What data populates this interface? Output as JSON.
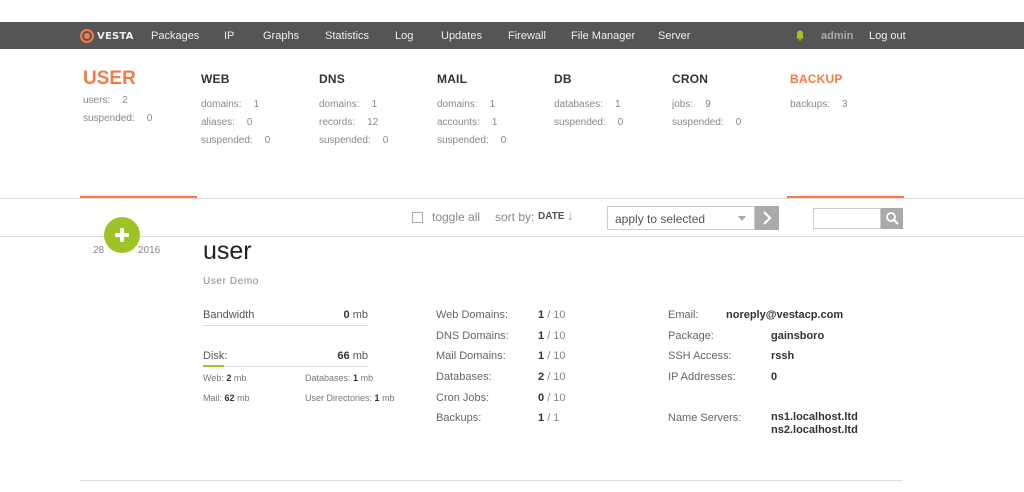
{
  "app": {
    "logo_text": "VESTA"
  },
  "nav": {
    "items": [
      {
        "label": "Packages"
      },
      {
        "label": "IP"
      },
      {
        "label": "Graphs"
      },
      {
        "label": "Statistics"
      },
      {
        "label": "Log"
      },
      {
        "label": "Updates"
      },
      {
        "label": "Firewall"
      },
      {
        "label": "File Manager"
      },
      {
        "label": "Server"
      }
    ],
    "bell_icon": "bell-icon",
    "user": "admin",
    "logout": "Log out"
  },
  "stats": {
    "user": {
      "title": "USER",
      "rows": [
        {
          "label": "users:",
          "value": "2"
        },
        {
          "label": "suspended:",
          "value": "0"
        }
      ]
    },
    "web": {
      "title": "WEB",
      "rows": [
        {
          "label": "domains:",
          "value": "1"
        },
        {
          "label": "aliases:",
          "value": "0"
        },
        {
          "label": "suspended:",
          "value": "0"
        }
      ]
    },
    "dns": {
      "title": "DNS",
      "rows": [
        {
          "label": "domains:",
          "value": "1"
        },
        {
          "label": "records:",
          "value": "12"
        },
        {
          "label": "suspended:",
          "value": "0"
        }
      ]
    },
    "mail": {
      "title": "MAIL",
      "rows": [
        {
          "label": "domains:",
          "value": "1"
        },
        {
          "label": "accounts:",
          "value": "1"
        },
        {
          "label": "suspended:",
          "value": "0"
        }
      ]
    },
    "db": {
      "title": "DB",
      "rows": [
        {
          "label": "databases:",
          "value": "1"
        },
        {
          "label": "suspended:",
          "value": "0"
        }
      ]
    },
    "cron": {
      "title": "CRON",
      "rows": [
        {
          "label": "jobs:",
          "value": "9"
        },
        {
          "label": "suspended:",
          "value": "0"
        }
      ]
    },
    "backup": {
      "title": "BACKUP",
      "rows": [
        {
          "label": "backups:",
          "value": "3"
        }
      ]
    }
  },
  "toolbar": {
    "toggle_all": "toggle all",
    "sort_by": "sort by:",
    "sort_field": "DATE",
    "sort_arrow": "↓",
    "apply_select": "apply to selected",
    "search_placeholder": ""
  },
  "user_row": {
    "date_day": "28",
    "date_year": "2016",
    "name": "user",
    "full_name": "User Demo",
    "bandwidth": {
      "label": "Bandwidth",
      "value": "0",
      "unit": "mb",
      "fraction": 0
    },
    "disk": {
      "label": "Disk:",
      "value": "66",
      "unit": "mb",
      "fraction": 0.13
    },
    "disk_details": {
      "web_label": "Web:",
      "web_value": "2",
      "web_unit": "mb",
      "db_label": "Databases:",
      "db_value": "1",
      "db_unit": "mb",
      "mail_label": "Mail:",
      "mail_value": "62",
      "mail_unit": "mb",
      "dirs_label": "User Directories:",
      "dirs_value": "1",
      "dirs_unit": "mb"
    },
    "limits": [
      {
        "label": "Web Domains:",
        "used": "1",
        "total": "/ 10"
      },
      {
        "label": "DNS Domains:",
        "used": "1",
        "total": "/ 10"
      },
      {
        "label": "Mail Domains:",
        "used": "1",
        "total": "/ 10"
      },
      {
        "label": "Databases:",
        "used": "2",
        "total": "/ 10"
      },
      {
        "label": "Cron Jobs:",
        "used": "0",
        "total": "/ 10"
      },
      {
        "label": "Backups:",
        "used": "1",
        "total": "/ 1"
      }
    ],
    "info": {
      "email_label": "Email:",
      "email": "noreply@vestacp.com",
      "package_label": "Package:",
      "package": "gainsboro",
      "ssh_label": "SSH Access:",
      "ssh": "rssh",
      "ip_label": "IP Addresses:",
      "ip": "0",
      "ns_label": "Name Servers:",
      "ns1": "ns1.localhost.ltd",
      "ns2": "ns2.localhost.ltd"
    }
  },
  "colors": {
    "accent": "#f47a46",
    "green": "#9ec327",
    "nav_bg": "#555555"
  }
}
